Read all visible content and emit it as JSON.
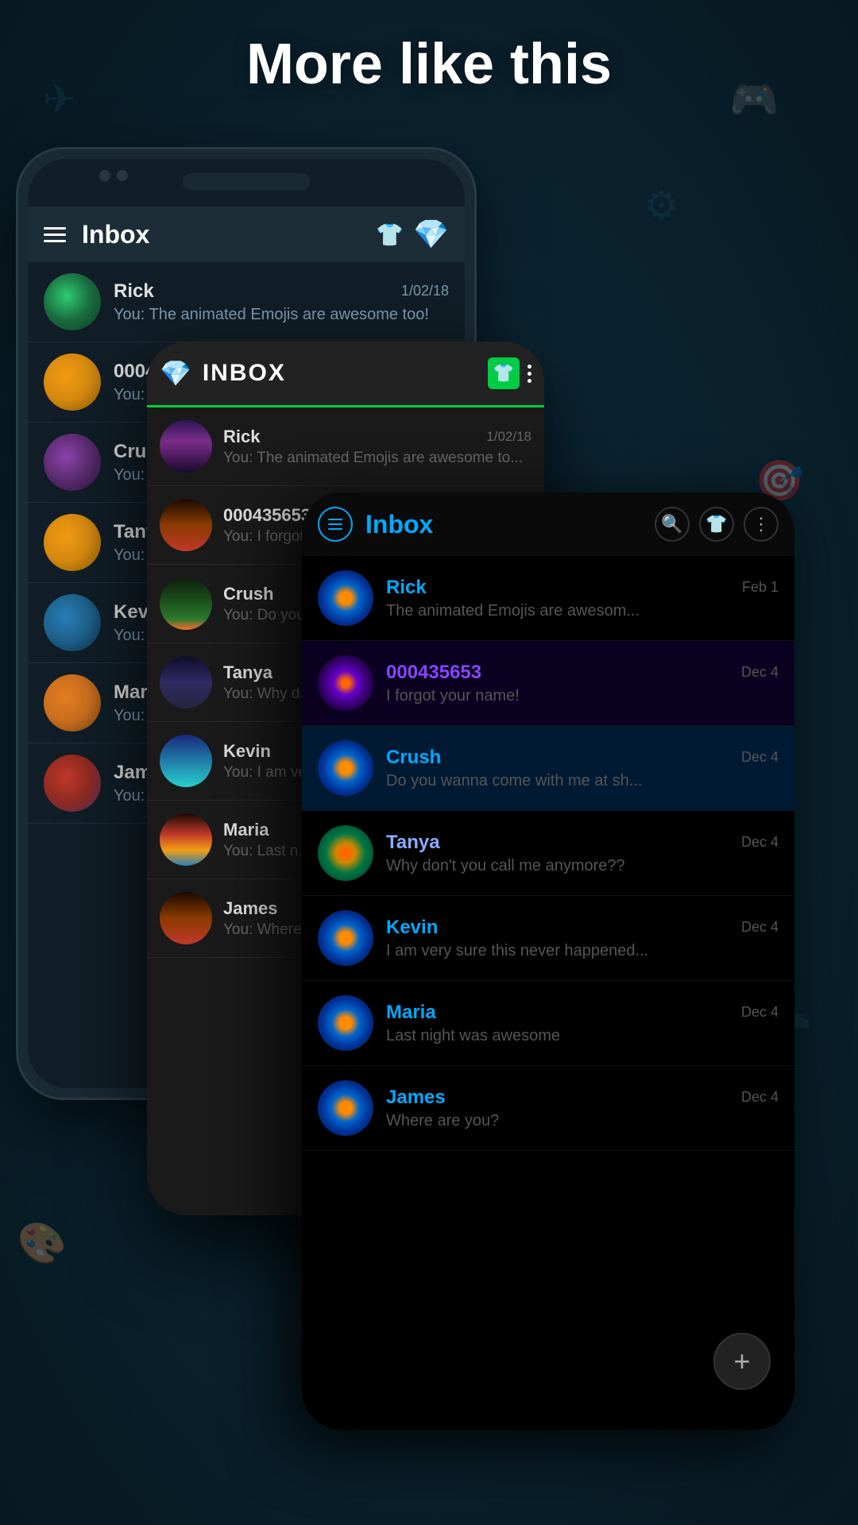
{
  "page": {
    "title": "More like this",
    "background_color": "#0d2535"
  },
  "phone_back": {
    "header": {
      "title": "Inbox",
      "gem_icon": "💎"
    },
    "conversations": [
      {
        "name": "Rick",
        "date": "1/02/18",
        "message": "You: The animated Emojis are awesome too!",
        "avatar_type": "avatar-gradient-green"
      },
      {
        "name": "0004...",
        "date": "",
        "message": "You: I f...",
        "avatar_type": "avatar-gradient-yellow"
      },
      {
        "name": "Crush",
        "date": "",
        "message": "You: D...",
        "avatar_type": "avatar-gradient-purple"
      },
      {
        "name": "Tanya",
        "date": "",
        "message": "You: W...",
        "avatar_type": "avatar-gradient-yellow"
      },
      {
        "name": "Kevin",
        "date": "",
        "message": "You: I a...",
        "avatar_type": "avatar-gradient-blue"
      },
      {
        "name": "Maria",
        "date": "",
        "message": "You: L...",
        "avatar_type": "avatar-gradient-orange"
      },
      {
        "name": "James",
        "date": "",
        "message": "You: W...",
        "avatar_type": "avatar-gradient-pink"
      }
    ]
  },
  "phone_mid": {
    "header": {
      "title": "INBOX",
      "gem_icon": "💎"
    },
    "conversations": [
      {
        "name": "Rick",
        "date": "1/02/18",
        "message": "You: The animated Emojis are awesome to...",
        "avatar_type": "av-mountain-purple"
      },
      {
        "name": "000435653",
        "date": "",
        "message": "You: I forgot...",
        "avatar_type": "av-bridge-red"
      },
      {
        "name": "Crush",
        "date": "",
        "message": "You: Do you...",
        "avatar_type": "av-forest-dark"
      },
      {
        "name": "Tanya",
        "date": "",
        "message": "You: Why d...",
        "avatar_type": "av-night-purple"
      },
      {
        "name": "Kevin",
        "date": "",
        "message": "You: I am ve...",
        "avatar_type": "av-lake-blue"
      },
      {
        "name": "Maria",
        "date": "",
        "message": "You: Last n...",
        "avatar_type": "av-lake-blue"
      },
      {
        "name": "James",
        "date": "",
        "message": "You: Where...",
        "avatar_type": "av-sunset-orange"
      }
    ]
  },
  "phone_front": {
    "header": {
      "title": "Inbox"
    },
    "conversations": [
      {
        "name": "Rick",
        "date": "Feb 1",
        "message": "The animated Emojis are awesom...",
        "avatar_type": "flower-avatar"
      },
      {
        "name": "000435653",
        "date": "Dec 4",
        "message": "I forgot your name!",
        "avatar_type": "flower-avatar-purple"
      },
      {
        "name": "Crush",
        "date": "Dec 4",
        "message": "Do you wanna come with me at sh...",
        "avatar_type": "flower-avatar"
      },
      {
        "name": "Tanya",
        "date": "Dec 4",
        "message": "Why don't you call me anymore??",
        "avatar_type": "flower-avatar"
      },
      {
        "name": "Kevin",
        "date": "Dec 4",
        "message": "I am very sure this never happened...",
        "avatar_type": "flower-avatar"
      },
      {
        "name": "Maria",
        "date": "Dec 4",
        "message": "Last night was awesome",
        "avatar_type": "flower-avatar"
      },
      {
        "name": "James",
        "date": "Dec 4",
        "message": "Where are you?",
        "avatar_type": "flower-avatar"
      }
    ],
    "fab_label": "+"
  }
}
